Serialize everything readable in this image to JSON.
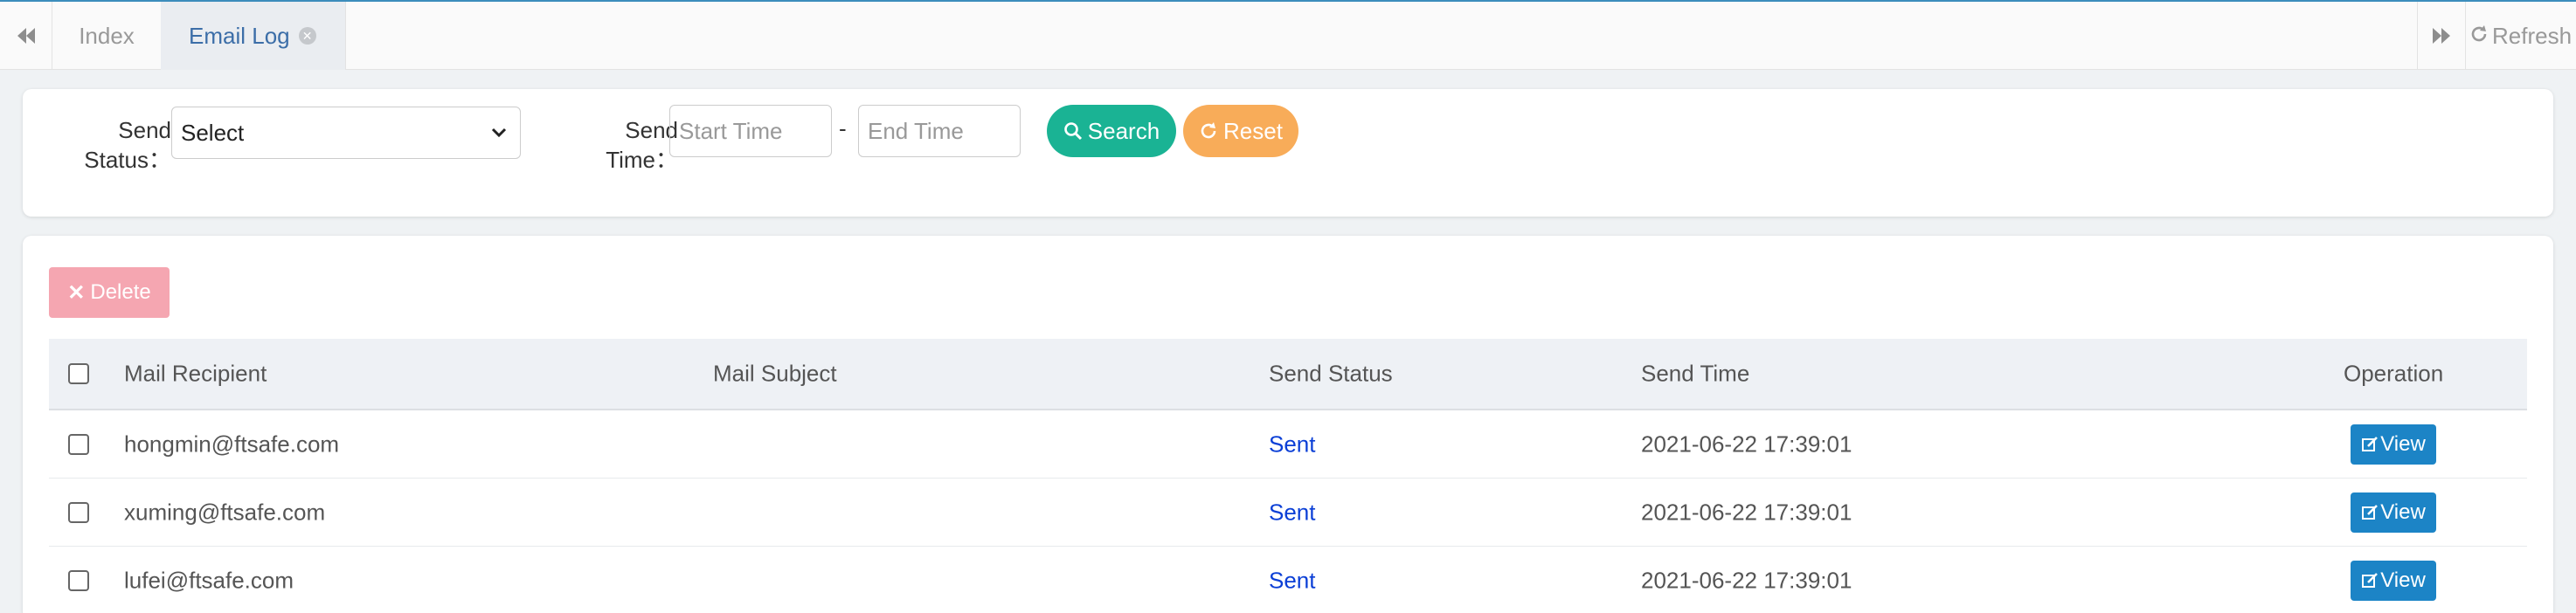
{
  "tabbar": {
    "tabs": [
      {
        "label": "Index",
        "active": false
      },
      {
        "label": "Email Log",
        "active": true
      }
    ],
    "refresh_label": "Refresh",
    "icons": {
      "left": "double-chevron-left-icon",
      "right": "double-chevron-right-icon",
      "refresh": "refresh-icon",
      "close": "close-circle-icon"
    }
  },
  "search": {
    "status_label": "Send Status：",
    "status_label_line1": "Send",
    "status_label_line2": "Status：",
    "status_value": "Select",
    "time_label_line1": "Send",
    "time_label_line2": "Time：",
    "start_placeholder": "Start Time",
    "end_placeholder": "End Time",
    "range_separator": "-",
    "search_button": "Search",
    "reset_button": "Reset"
  },
  "toolbar": {
    "delete_button": "Delete"
  },
  "table": {
    "columns": [
      "Mail Recipient",
      "Mail Subject",
      "Send Status",
      "Send Time",
      "Operation"
    ],
    "rows": [
      {
        "recipient": "hongmin@ftsafe.com",
        "subject": "",
        "status": "Sent",
        "time": "2021-06-22 17:39:01",
        "action": "View"
      },
      {
        "recipient": "xuming@ftsafe.com",
        "subject": "",
        "status": "Sent",
        "time": "2021-06-22 17:39:01",
        "action": "View"
      },
      {
        "recipient": "lufei@ftsafe.com",
        "subject": "",
        "status": "Sent",
        "time": "2021-06-22 17:39:01",
        "action": "View"
      }
    ]
  },
  "colors": {
    "accent": "#3c8dbc",
    "search_button": "#1ab394",
    "reset_button": "#f8ac59",
    "delete_button": "#f5a6b1",
    "view_button": "#1c84c6",
    "status_sent": "#0b3fd6"
  }
}
